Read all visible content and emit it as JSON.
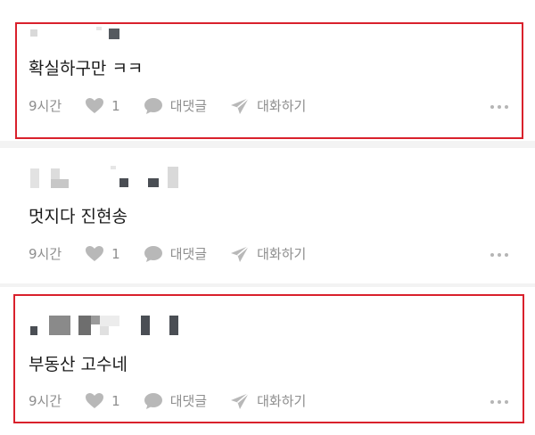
{
  "comments": [
    {
      "text": "확실하구만 ㅋㅋ",
      "time": "9시간",
      "likes": "1",
      "reply_label": "대댓글",
      "dm_label": "대화하기",
      "highlighted": true
    },
    {
      "text": "멋지다 진현송",
      "time": "9시간",
      "likes": "1",
      "reply_label": "대댓글",
      "dm_label": "대화하기",
      "highlighted": false
    },
    {
      "text": "부동산 고수네",
      "time": "9시간",
      "likes": "1",
      "reply_label": "대댓글",
      "dm_label": "대화하기",
      "highlighted": true
    }
  ],
  "icons": {
    "like": "heart-icon",
    "reply": "speech-bubble-icon",
    "dm": "paper-plane-icon",
    "more": "more-dots-icon"
  },
  "colors": {
    "highlight": "#d9212c",
    "meta_text": "#8e8e8e",
    "icon": "#b8b8b8",
    "separator": "#f3f3f3"
  }
}
